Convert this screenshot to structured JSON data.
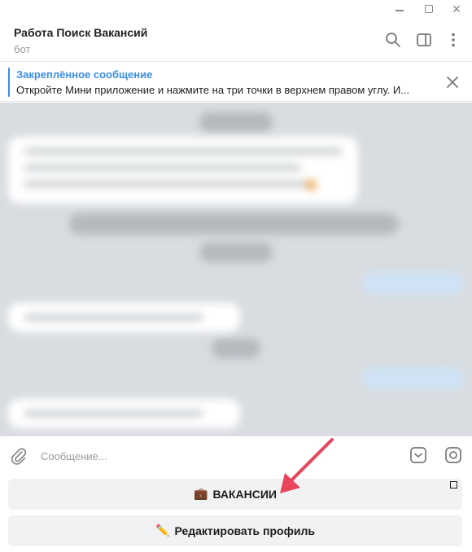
{
  "window": {
    "minimize_icon": "minimize-icon",
    "maximize_icon": "maximize-icon",
    "close_label": "✕"
  },
  "chat": {
    "title": "Работа Поиск Вакансий",
    "subtitle": "бот"
  },
  "pinned": {
    "title": "Закреплённое сообщение",
    "text": "Откройте Мини приложение и нажмите на три точки в верхнем правом углу. И..."
  },
  "composer": {
    "placeholder": "Сообщение..."
  },
  "keyboard": {
    "buttons": [
      {
        "emoji": "💼",
        "label": "ВАКАНСИИ"
      },
      {
        "emoji": "✏️",
        "label": "Редактировать профиль"
      }
    ]
  },
  "colors": {
    "accent": "#3a8ee6",
    "annotation_arrow": "#e8455a"
  }
}
